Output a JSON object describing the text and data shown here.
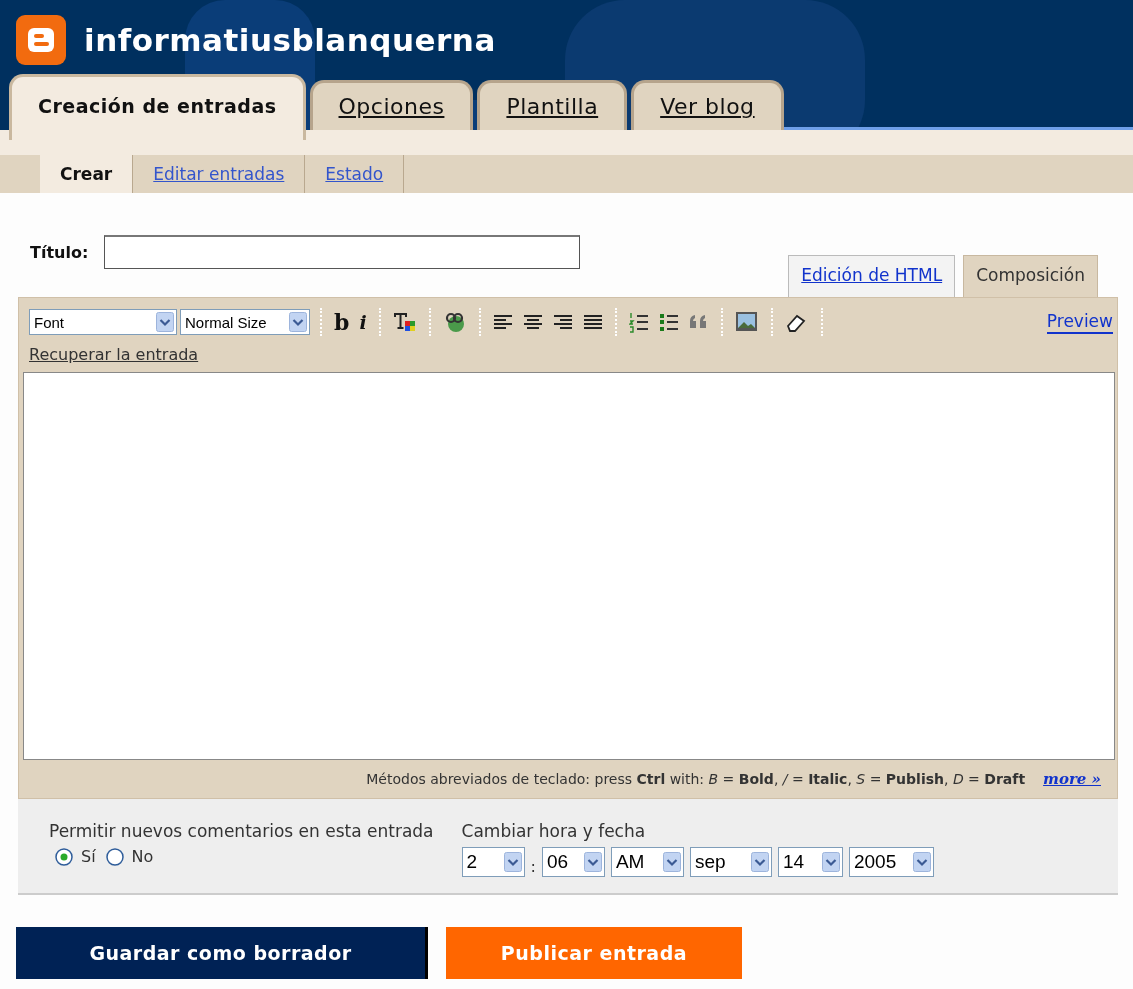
{
  "header": {
    "blog_name": "informatiusblanquerna"
  },
  "tabs": [
    {
      "label": "Creación de entradas",
      "selected": true
    },
    {
      "label": "Opciones",
      "selected": false
    },
    {
      "label": "Plantilla",
      "selected": false
    },
    {
      "label": "Ver blog",
      "selected": false
    }
  ],
  "subtabs": [
    {
      "label": "Crear",
      "selected": true
    },
    {
      "label": "Editar entradas",
      "selected": false
    },
    {
      "label": "Estado",
      "selected": false
    }
  ],
  "title_field": {
    "label": "Título:"
  },
  "editor_modes": [
    {
      "label": "Edición de HTML",
      "selected": false
    },
    {
      "label": "Composición",
      "selected": true
    }
  ],
  "toolbar": {
    "font_select": "Font",
    "size_select": "Normal Size",
    "groups": [
      [
        {
          "kind": "bold",
          "text": "b"
        },
        {
          "kind": "italic",
          "text": "i"
        }
      ],
      [
        {
          "kind": "textcolor"
        }
      ],
      [
        {
          "kind": "link"
        }
      ],
      [
        {
          "kind": "align-left"
        },
        {
          "kind": "align-center"
        },
        {
          "kind": "align-right"
        },
        {
          "kind": "align-justify"
        }
      ],
      [
        {
          "kind": "ordered-list"
        },
        {
          "kind": "bullet-list"
        },
        {
          "kind": "quote"
        }
      ],
      [
        {
          "kind": "image"
        }
      ],
      [
        {
          "kind": "eraser"
        }
      ]
    ],
    "preview": "Preview",
    "recover": "Recuperar la entrada"
  },
  "shortcuts": {
    "text": "Métodos abreviados de teclado: press **Ctrl** with: *B* = **Bold**, */* = **Italic**, *S* = **Publish**, *D* = **Draft**",
    "more": "more »"
  },
  "comments": {
    "label": "Permitir nuevos comentarios en esta entrada",
    "options": [
      {
        "label": "Sí",
        "selected": true
      },
      {
        "label": "No",
        "selected": false
      }
    ]
  },
  "datetime": {
    "label": "Cambiar hora y fecha",
    "hour": "2",
    "separator": ":",
    "minute": "06",
    "ampm": "AM",
    "month": "sep",
    "day": "14",
    "year": "2005"
  },
  "buttons": [
    {
      "kind": "draft",
      "label": "Guardar como borrador"
    },
    {
      "kind": "publish",
      "label": "Publicar entrada"
    }
  ]
}
